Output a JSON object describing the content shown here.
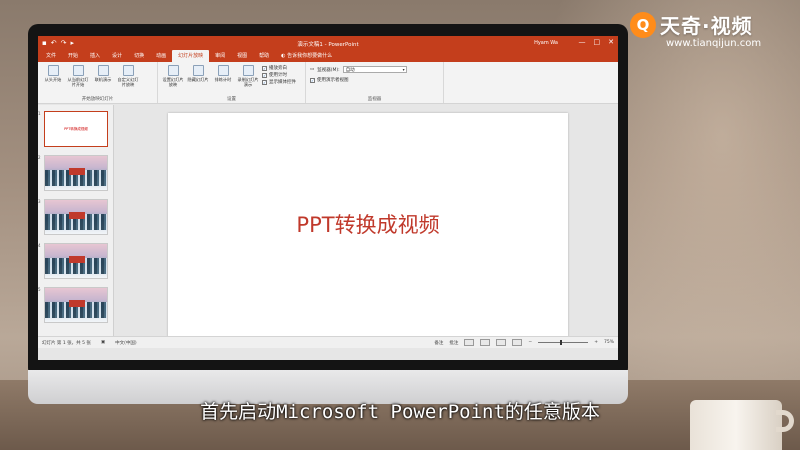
{
  "app": {
    "doc_title": "演示文稿1 - PowerPoint",
    "user": "Hyam Wa",
    "qat_icons": [
      "save-icon",
      "undo-icon",
      "redo-icon",
      "present-icon"
    ],
    "window_buttons": [
      "—",
      "□",
      "✕"
    ]
  },
  "tabs": [
    {
      "label": "文件",
      "active": false
    },
    {
      "label": "开始",
      "active": false
    },
    {
      "label": "插入",
      "active": false
    },
    {
      "label": "设计",
      "active": false
    },
    {
      "label": "切换",
      "active": false
    },
    {
      "label": "动画",
      "active": false
    },
    {
      "label": "幻灯片放映",
      "active": true
    },
    {
      "label": "审阅",
      "active": false
    },
    {
      "label": "视图",
      "active": false
    },
    {
      "label": "帮助",
      "active": false
    }
  ],
  "tellme": "告诉我你想要做什么",
  "ribbon": {
    "group1": {
      "label": "开始放映幻灯片",
      "buttons": [
        "从头开始",
        "从当前幻灯片开始",
        "联机演示",
        "自定义幻灯片放映"
      ]
    },
    "group2": {
      "label": "设置",
      "buttons": [
        "设置幻灯片放映",
        "隐藏幻灯片",
        "排练计时",
        "录制幻灯片演示"
      ],
      "checks": [
        {
          "label": "播放旁白",
          "checked": true
        },
        {
          "label": "使用计时",
          "checked": true
        },
        {
          "label": "显示媒体控件",
          "checked": true
        }
      ]
    },
    "group3": {
      "label": "监视器",
      "monitor_label": "监视器(M):",
      "monitor_value": "自动",
      "presenter_view": "使用演示者视图"
    }
  },
  "thumbnails": [
    {
      "num": "1",
      "title": "PPT转换成视频",
      "type": "title"
    },
    {
      "num": "2",
      "type": "snow"
    },
    {
      "num": "3",
      "type": "snow"
    },
    {
      "num": "4",
      "type": "snow"
    },
    {
      "num": "5",
      "type": "snow"
    }
  ],
  "slide": {
    "title": "PPT转换成视频"
  },
  "status": {
    "slide_info": "幻灯片 第 1 张，共 5 张",
    "language": "中文(中国)",
    "notes": "备注",
    "comments": "批注",
    "zoom": "75%"
  },
  "brand": {
    "badge": "Q",
    "name": "天奇·视频",
    "url": "www.tianqijun.com"
  },
  "subtitle": "首先启动Microsoft PowerPoint的任意版本"
}
